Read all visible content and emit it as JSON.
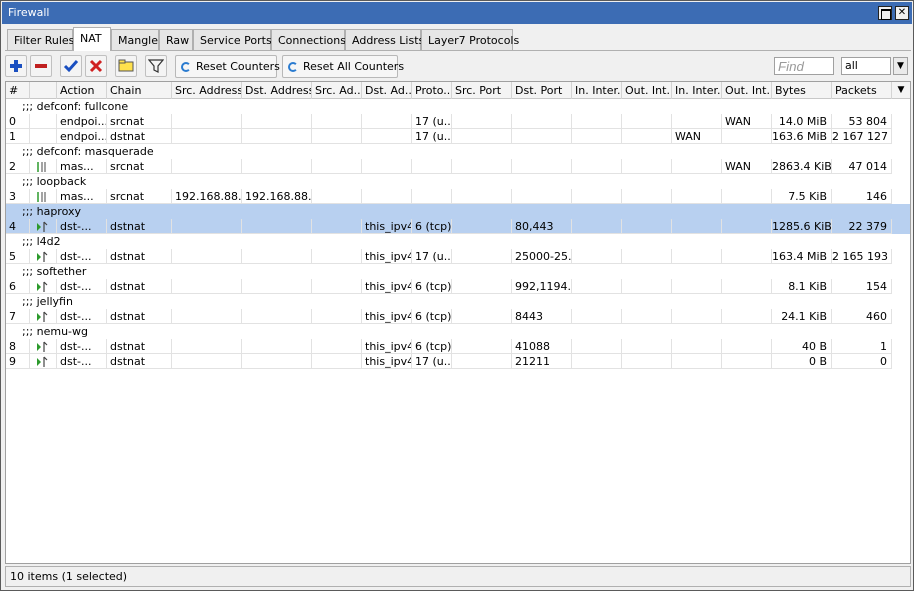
{
  "window": {
    "title": "Firewall"
  },
  "tabs": [
    "Filter Rules",
    "NAT",
    "Mangle",
    "Raw",
    "Service Ports",
    "Connections",
    "Address Lists",
    "Layer7 Protocols"
  ],
  "active_tab": "NAT",
  "toolbar": {
    "reset_counters": "Reset Counters",
    "reset_all_counters": "Reset All Counters",
    "find_placeholder": "Find",
    "filter_value": "all"
  },
  "columns": [
    "#",
    "",
    "Action",
    "Chain",
    "Src. Address",
    "Dst. Address",
    "Src. Ad...",
    "Dst. Ad...",
    "Proto...",
    "Src. Port",
    "Dst. Port",
    "In. Inter...",
    "Out. Int...",
    "In. Inter...",
    "Out. Int...",
    "Bytes",
    "Packets"
  ],
  "rows": [
    {
      "comment": ";;; defconf: fullcone"
    },
    {
      "num": "0",
      "icon": "",
      "action": "endpoi...",
      "chain": "srcnat",
      "src_addr": "",
      "dst_addr": "",
      "src_al": "",
      "dst_al": "",
      "proto": "17 (u...",
      "src_port": "",
      "dst_port": "",
      "in_if": "",
      "out_if": "",
      "in_il": "",
      "out_il": "WAN",
      "bytes": "14.0 MiB",
      "packets": "53 804"
    },
    {
      "num": "1",
      "icon": "",
      "action": "endpoi...",
      "chain": "dstnat",
      "src_addr": "",
      "dst_addr": "",
      "src_al": "",
      "dst_al": "",
      "proto": "17 (u...",
      "src_port": "",
      "dst_port": "",
      "in_if": "",
      "out_if": "",
      "in_il": "WAN",
      "out_il": "",
      "bytes": "163.6 MiB",
      "packets": "2 167 127"
    },
    {
      "comment": ";;; defconf: masquerade"
    },
    {
      "num": "2",
      "icon": "masquerade",
      "action": "mas...",
      "chain": "srcnat",
      "src_addr": "",
      "dst_addr": "",
      "src_al": "",
      "dst_al": "",
      "proto": "",
      "src_port": "",
      "dst_port": "",
      "in_if": "",
      "out_if": "",
      "in_il": "",
      "out_il": "WAN",
      "bytes": "2863.4 KiB",
      "packets": "47 014"
    },
    {
      "comment": ";;; loopback"
    },
    {
      "num": "3",
      "icon": "masquerade",
      "action": "mas...",
      "chain": "srcnat",
      "src_addr": "192.168.88....",
      "dst_addr": "192.168.88....",
      "src_al": "",
      "dst_al": "",
      "proto": "",
      "src_port": "",
      "dst_port": "",
      "in_if": "",
      "out_if": "",
      "in_il": "",
      "out_il": "",
      "bytes": "7.5 KiB",
      "packets": "146"
    },
    {
      "comment": ";;; haproxy",
      "selected": true
    },
    {
      "num": "4",
      "icon": "dst-nat",
      "action": "dst-...",
      "chain": "dstnat",
      "src_addr": "",
      "dst_addr": "",
      "src_al": "",
      "dst_al": "this_ipv4",
      "proto": "6 (tcp)",
      "src_port": "",
      "dst_port": "80,443",
      "in_if": "",
      "out_if": "",
      "in_il": "",
      "out_il": "",
      "bytes": "1285.6 KiB",
      "packets": "22 379",
      "selected": true
    },
    {
      "comment": ";;; l4d2"
    },
    {
      "num": "5",
      "icon": "dst-nat",
      "action": "dst-...",
      "chain": "dstnat",
      "src_addr": "",
      "dst_addr": "",
      "src_al": "",
      "dst_al": "this_ipv4",
      "proto": "17 (u...",
      "src_port": "",
      "dst_port": "25000-25...",
      "in_if": "",
      "out_if": "",
      "in_il": "",
      "out_il": "",
      "bytes": "163.4 MiB",
      "packets": "2 165 193"
    },
    {
      "comment": ";;; softether"
    },
    {
      "num": "6",
      "icon": "dst-nat",
      "action": "dst-...",
      "chain": "dstnat",
      "src_addr": "",
      "dst_addr": "",
      "src_al": "",
      "dst_al": "this_ipv4",
      "proto": "6 (tcp)",
      "src_port": "",
      "dst_port": "992,1194...",
      "in_if": "",
      "out_if": "",
      "in_il": "",
      "out_il": "",
      "bytes": "8.1 KiB",
      "packets": "154"
    },
    {
      "comment": ";;; jellyfin"
    },
    {
      "num": "7",
      "icon": "dst-nat",
      "action": "dst-...",
      "chain": "dstnat",
      "src_addr": "",
      "dst_addr": "",
      "src_al": "",
      "dst_al": "this_ipv4",
      "proto": "6 (tcp)",
      "src_port": "",
      "dst_port": "8443",
      "in_if": "",
      "out_if": "",
      "in_il": "",
      "out_il": "",
      "bytes": "24.1 KiB",
      "packets": "460"
    },
    {
      "comment": ";;; nemu-wg"
    },
    {
      "num": "8",
      "icon": "dst-nat",
      "action": "dst-...",
      "chain": "dstnat",
      "src_addr": "",
      "dst_addr": "",
      "src_al": "",
      "dst_al": "this_ipv4",
      "proto": "6 (tcp)",
      "src_port": "",
      "dst_port": "41088",
      "in_if": "",
      "out_if": "",
      "in_il": "",
      "out_il": "",
      "bytes": "40 B",
      "packets": "1"
    },
    {
      "num": "9",
      "icon": "dst-nat",
      "action": "dst-...",
      "chain": "dstnat",
      "src_addr": "",
      "dst_addr": "",
      "src_al": "",
      "dst_al": "this_ipv4",
      "proto": "17 (u...",
      "src_port": "",
      "dst_port": "21211",
      "in_if": "",
      "out_if": "",
      "in_il": "",
      "out_il": "",
      "bytes": "0 B",
      "packets": "0"
    }
  ],
  "status": "10 items (1 selected)",
  "colors": {
    "title_bg": "#3c6cb4",
    "selection": "#b8d0f0",
    "add": "#1a4fc0",
    "remove": "#c02020",
    "enable": "#1a4fc0",
    "disable": "#d02020"
  }
}
